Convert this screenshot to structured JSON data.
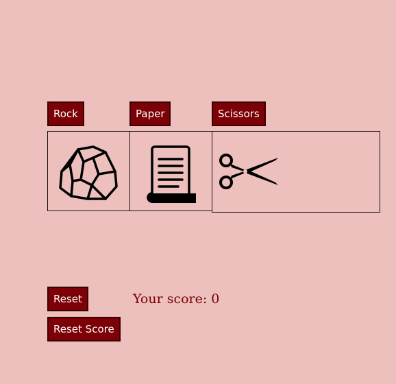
{
  "choices": {
    "rock_label": "Rock",
    "paper_label": "Paper",
    "scissors_label": "Scissors"
  },
  "images": {
    "rock": "rock-icon",
    "paper": "paper-scroll-icon",
    "scissors": "scissors-icon"
  },
  "controls": {
    "reset_label": "Reset",
    "reset_score_label": "Reset Score"
  },
  "score": {
    "text": "Your score: 0"
  },
  "colors": {
    "background": "#edc0bd",
    "button": "#7c0005",
    "button_text": "#ffffff",
    "score_text": "#7c0005"
  }
}
